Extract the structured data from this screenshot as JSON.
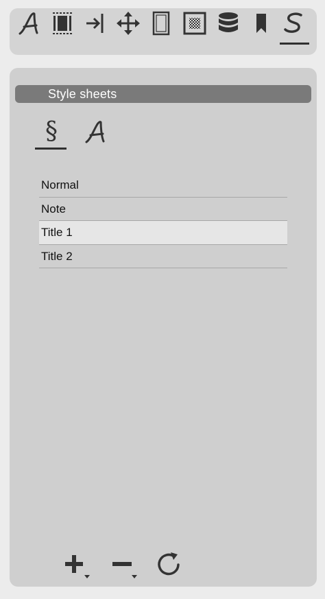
{
  "toolbar": {
    "tools": [
      {
        "icon": "character-style-icon"
      },
      {
        "icon": "paragraph-frame-icon"
      },
      {
        "icon": "tab-stop-icon"
      },
      {
        "icon": "move-arrows-icon"
      },
      {
        "icon": "page-frame-icon"
      },
      {
        "icon": "pattern-fill-icon"
      },
      {
        "icon": "database-icon"
      },
      {
        "icon": "bookmark-icon"
      },
      {
        "icon": "style-sheets-icon",
        "active": true
      }
    ]
  },
  "panel": {
    "title": "Style sheets",
    "mode_tabs": [
      {
        "label": "§",
        "icon": "paragraph-styles-icon",
        "active": true
      },
      {
        "icon": "character-styles-icon",
        "active": false
      }
    ],
    "styles": [
      {
        "label": "Normal",
        "selected": false
      },
      {
        "label": "Note",
        "selected": false
      },
      {
        "label": "Title 1",
        "selected": true
      },
      {
        "label": "Title 2",
        "selected": false
      }
    ]
  },
  "colors": {
    "window_bg": "#ececec",
    "toolbar_bg": "#d4d4d4",
    "panel_bg": "#cfcfcf",
    "header_bg": "#7a7a7a",
    "selected_row": "#e6e6e6",
    "icon": "#333333"
  },
  "bottom_actions": [
    {
      "icon": "add-icon"
    },
    {
      "icon": "remove-icon"
    },
    {
      "icon": "refresh-icon"
    }
  ]
}
